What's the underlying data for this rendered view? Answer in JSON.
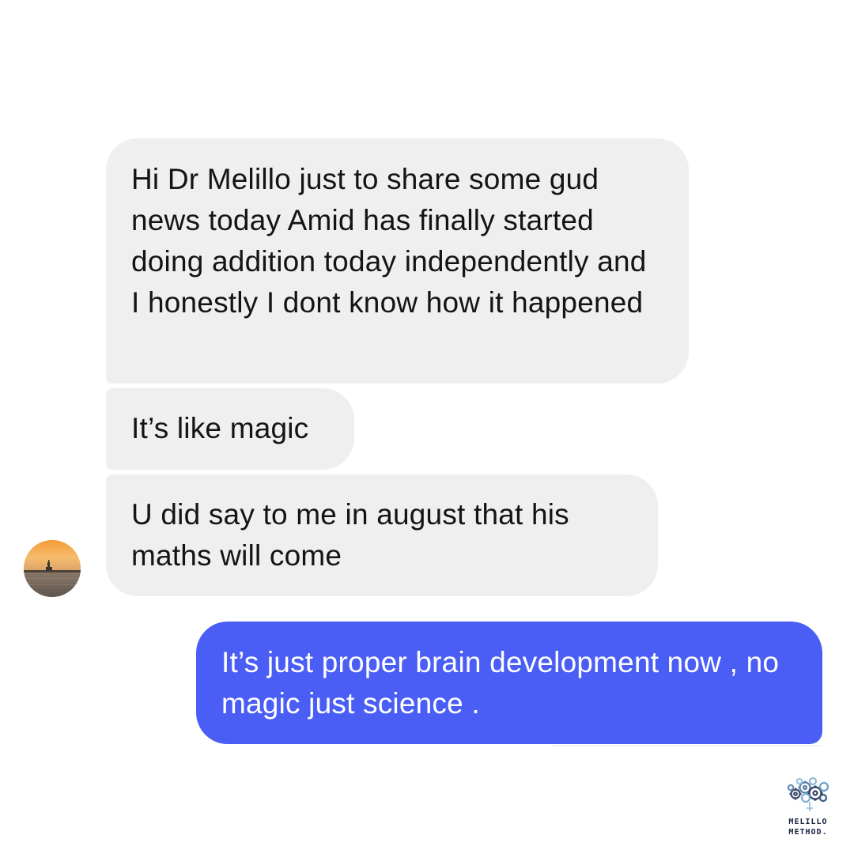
{
  "conversation": {
    "incoming_messages": [
      {
        "text": "Hi Dr Melillo just to share some gud news today Amid has finally started doing addition today independently and I honestly I dont know how it happened"
      },
      {
        "text": "It’s like magic"
      },
      {
        "text": "U did say to me in august that his maths will come"
      }
    ],
    "outgoing_messages": [
      {
        "text": "It’s just proper brain development now , no magic just science ."
      }
    ],
    "sender_avatar": {
      "icon": "sunset-photo-avatar"
    }
  },
  "branding": {
    "logo_line1": "MELILLO",
    "logo_line2": "METHOD.",
    "logo_icon": "gear-brain-icon"
  },
  "colors": {
    "incoming_bubble": "#efeff0",
    "outgoing_bubble": "#4a5ef6",
    "incoming_text": "#141414",
    "outgoing_text": "#ffffff",
    "logo_navy": "#1a2340"
  }
}
